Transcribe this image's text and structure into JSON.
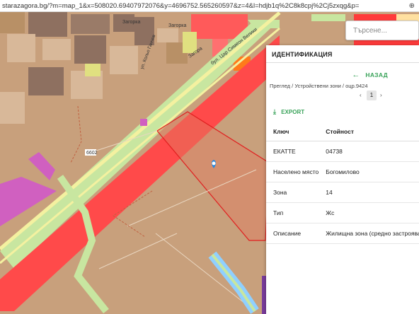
{
  "browser": {
    "url": "starazagora.bg/?m=map_1&x=508020.69407972076&y=4696752.565260597&z=4&l=hdjb1q%2C8k8cpj%2Cj5zxqg&p=",
    "zoom_icon": "zoom-icon"
  },
  "map": {
    "labels": {
      "street_1": "Загорка",
      "street_2": "Загорка",
      "street_3": "ул. Кольо Ганчев",
      "street_4": "Загора",
      "boulevard": "бул. Цар Симеон Велики",
      "road_number": "6602"
    },
    "search": {
      "placeholder": "Търсене..."
    }
  },
  "panel": {
    "title": "ИДЕНТИФИКАЦИЯ",
    "back_label": "НАЗАД",
    "breadcrumb": [
      "Преглед",
      "Устройствени зони",
      "оцр.9424"
    ],
    "current_page": "1",
    "export_label": "EXPORT",
    "table": {
      "headers": [
        "Ключ",
        "Стойност"
      ],
      "rows": [
        {
          "key": "ЕКАТТЕ",
          "value": "04738"
        },
        {
          "key": "Населено място",
          "value": "Богомилово"
        },
        {
          "key": "Зона",
          "value": "14"
        },
        {
          "key": "Тип",
          "value": "Жс"
        },
        {
          "key": "Описание",
          "value": "Жилищна зона (средно застрояване)"
        }
      ]
    }
  },
  "colors": {
    "residential_zone": "#c8a07c",
    "road": "#ff3b3b",
    "accent_green": "#3aa35a",
    "marker": "#1e88e5"
  }
}
